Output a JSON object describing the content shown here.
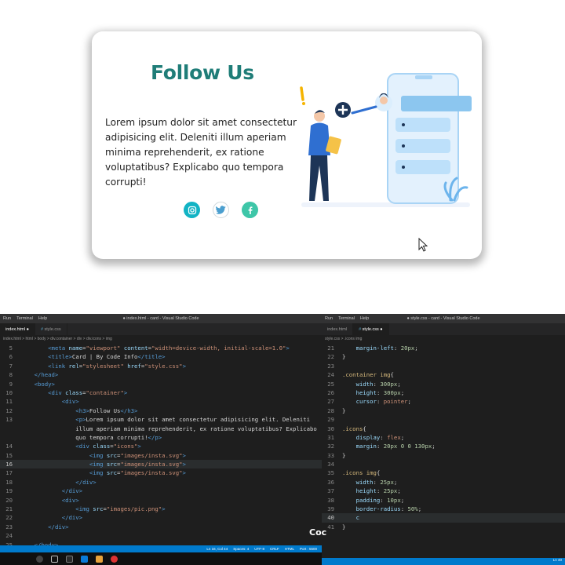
{
  "card": {
    "title": "Follow Us",
    "paragraph": "Lorem ipsum dolor sit amet consectetur adipisicing elit. Deleniti illum aperiam minima reprehenderit, ex ratione voluptatibus? Explicabo quo tempora corrupti!",
    "icons": [
      "instagram-icon",
      "twitter-icon",
      "facebook-icon"
    ],
    "accent": "#1f7d78"
  },
  "left_editor": {
    "menu": [
      "Run",
      "Terminal",
      "Help"
    ],
    "window_title": "● index.html - card - Visual Studio Code",
    "tabs": [
      {
        "label": "index.html",
        "active": true
      },
      {
        "label": "style.css",
        "active": false
      }
    ],
    "breadcrumb": "index.html > html > body > div.container > div > div.icons > img",
    "status": [
      "Ln 16, Col 44",
      "Spaces: 4",
      "UTF-8",
      "CRLF",
      "HTML",
      "Port : 5500"
    ]
  },
  "right_editor": {
    "menu": [
      "Run",
      "Terminal",
      "Help"
    ],
    "window_title": "● style.css - card - Visual Studio Code",
    "tabs": [
      {
        "label": "index.html",
        "active": false
      },
      {
        "label": "style.css",
        "active": true
      }
    ],
    "breadcrumb": "style.css > .icons img",
    "status": "Ln 40"
  },
  "watermark": "Coc",
  "colors": {
    "tag": "#569cd6",
    "attr": "#9cdcfe",
    "string": "#ce9178",
    "selector": "#d7ba7d",
    "number": "#b5cea8",
    "status": "#007acc"
  }
}
